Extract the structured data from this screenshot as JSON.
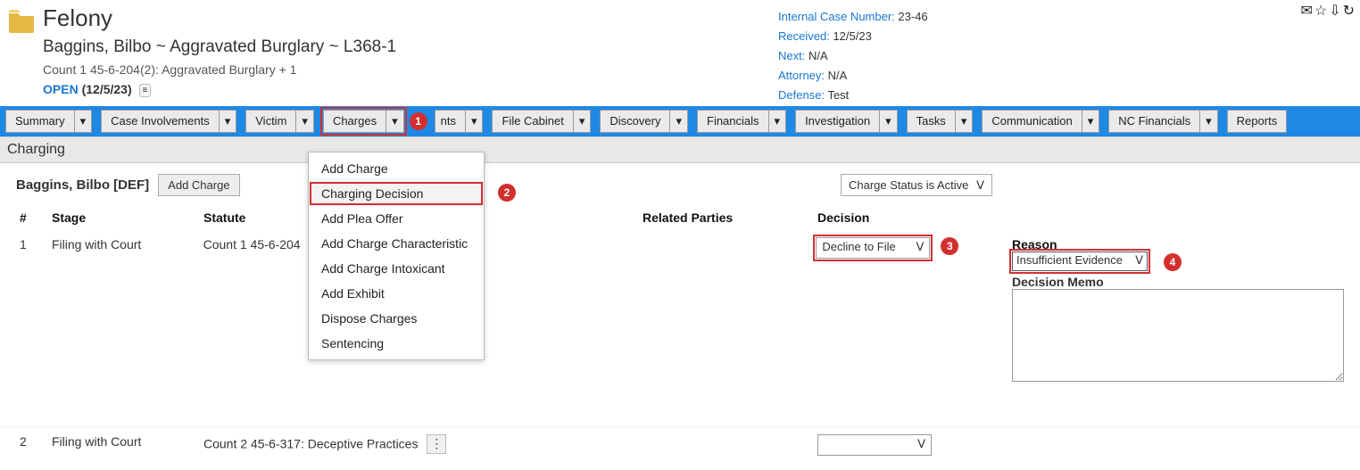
{
  "header": {
    "case_type": "Felony",
    "case_title": "Baggins, Bilbo ~ Aggravated Burglary ~ L368-1",
    "case_sub": "Count 1 45-6-204(2): Aggravated Burglary + 1",
    "status_label": "OPEN",
    "status_date": "(12/5/23)"
  },
  "meta": {
    "internal_label": "Internal Case Number:",
    "internal_val": "23-46",
    "received_label": "Received:",
    "received_val": "12/5/23",
    "next_label": "Next:",
    "next_val": "N/A",
    "attorney_label": "Attorney:",
    "attorney_val": "N/A",
    "defense_label": "Defense:",
    "defense_val": "Test"
  },
  "nav": {
    "summary": "Summary",
    "case_inv": "Case Involvements",
    "victim": "Victim",
    "charges": "Charges",
    "partial_nts": "nts",
    "file_cabinet": "File Cabinet",
    "discovery": "Discovery",
    "financials": "Financials",
    "investigation": "Investigation",
    "tasks": "Tasks",
    "communication": "Communication",
    "nc_financials": "NC Financials",
    "reports": "Reports"
  },
  "dropdown": {
    "add_charge": "Add Charge",
    "charging_decision": "Charging Decision",
    "add_plea": "Add Plea Offer",
    "add_char": "Add Charge Characteristic",
    "add_intox": "Add Charge Intoxicant",
    "add_exhibit": "Add Exhibit",
    "dispose": "Dispose Charges",
    "sentencing": "Sentencing"
  },
  "section": {
    "title": "Charging"
  },
  "defendant": {
    "name": "Baggins, Bilbo [DEF]",
    "add_btn": "Add Charge",
    "status_filter": "Charge Status is Active"
  },
  "columns": {
    "num": "#",
    "stage": "Stage",
    "statute": "Statute",
    "related": "Related Parties",
    "decision": "Decision"
  },
  "rows": [
    {
      "num": "1",
      "stage": "Filing with Court",
      "statute": "Count 1 45-6-204",
      "decision": "Decline to File",
      "reason_label": "Reason",
      "reason": "Insufficient Evidence",
      "memo_label": "Decision Memo"
    },
    {
      "num": "2",
      "stage": "Filing with Court",
      "statute": "Count 2 45-6-317: Deceptive Practices",
      "decision": ""
    }
  ],
  "anno": {
    "a1": "1",
    "a2": "2",
    "a3": "3",
    "a4": "4"
  },
  "caret": "▾",
  "dots": "⋮",
  "select_caret": "ᐯ",
  "tiny_icon": "≡"
}
